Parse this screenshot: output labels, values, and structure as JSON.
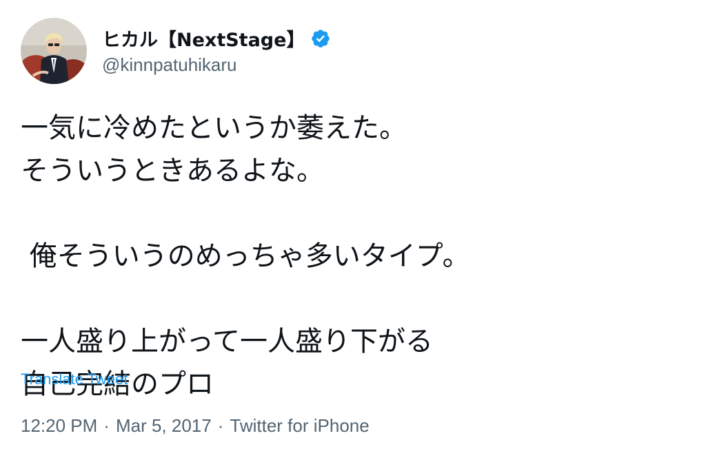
{
  "user": {
    "display_name": "ヒカル【NextStage】",
    "handle": "@kinnpatuhikaru",
    "verified": true,
    "verified_icon": "verified-badge-icon",
    "verified_color": "#1d9bf0"
  },
  "tweet": {
    "lines": [
      "一気に冷めたというか萎えた。",
      "そういうときあるよな。",
      "",
      " 俺そういうのめっちゃ多いタイプ。",
      "",
      "一人盛り上がって一人盛り下がる",
      "自己完結のプロ"
    ],
    "translate_label": "Translate Tweet",
    "time": "12:20 PM",
    "date": "Mar 5, 2017",
    "separator": "·",
    "source": "Twitter for iPhone"
  },
  "colors": {
    "text": "#0f1419",
    "secondary": "#536471",
    "link": "#1d9bf0"
  }
}
